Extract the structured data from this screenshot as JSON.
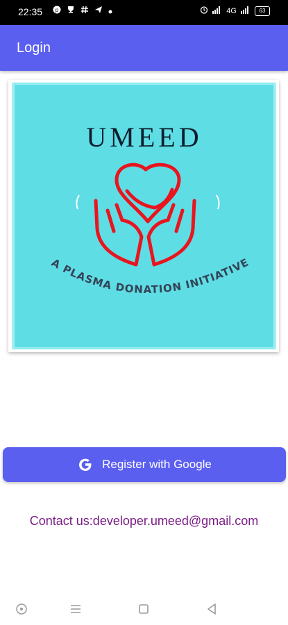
{
  "status_bar": {
    "time": "22:35",
    "left_icons": [
      "pinterest-icon",
      "trophy-icon",
      "hashtag-icon",
      "telegram-icon",
      "dot-icon"
    ],
    "right_icons": [
      "alarm-icon",
      "signal-icon",
      "wifi-icon",
      "battery-icon"
    ],
    "network_label": "4G",
    "battery_level": "63"
  },
  "app_bar": {
    "title": "Login"
  },
  "logo": {
    "title": "UMEED",
    "tagline": "A PLASMA DONATION INITIATIVE",
    "background_color": "#5fdde5",
    "heart_color": "#e8151f",
    "text_color": "#0c1e2c"
  },
  "register_button": {
    "label": "Register with Google",
    "icon": "google-icon"
  },
  "contact": {
    "text": "Contact us:developer.umeed@gmail.com"
  },
  "nav_bar": {
    "icons": [
      "assistant-icon",
      "menu-icon",
      "home-icon",
      "back-icon"
    ]
  },
  "colors": {
    "primary": "#5b5ff0",
    "contact_text": "#7b1d86"
  }
}
